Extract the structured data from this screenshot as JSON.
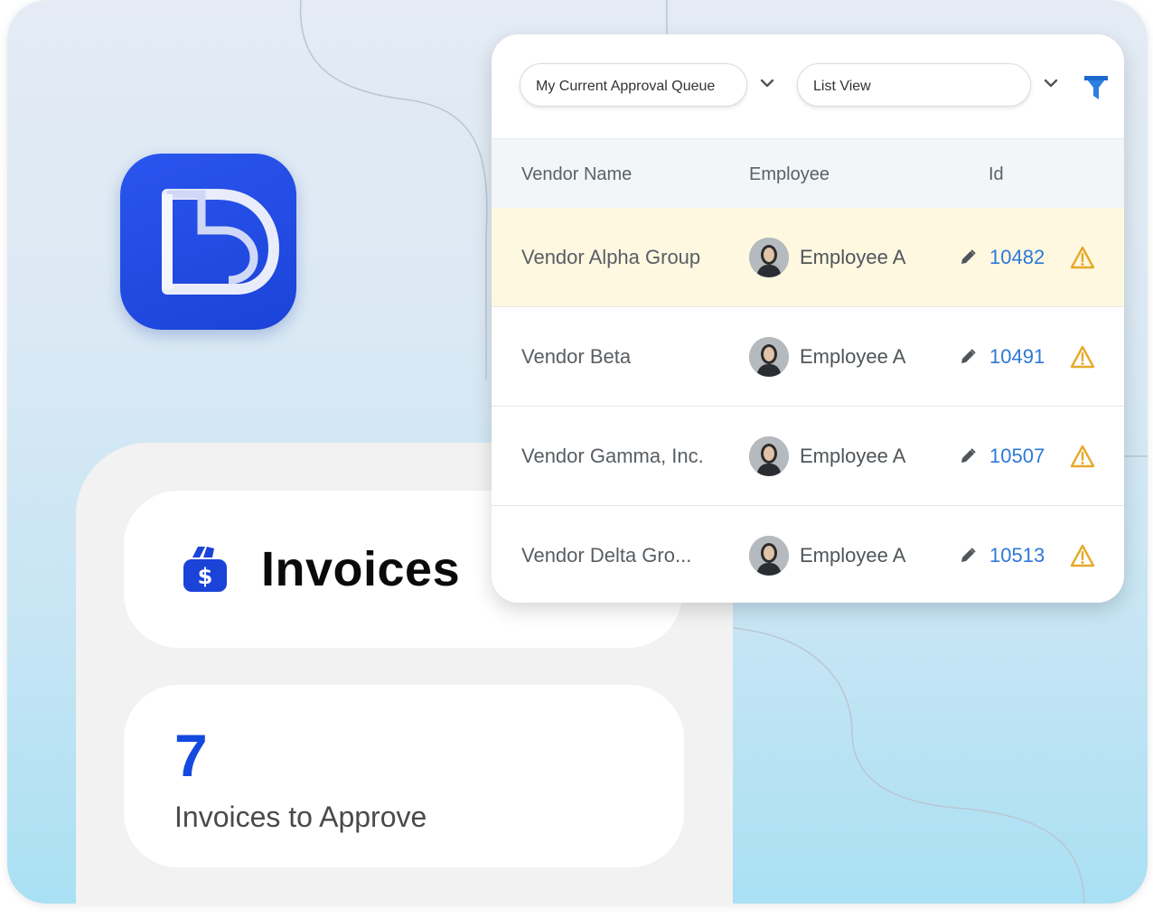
{
  "app": {
    "logo_icon": "brand-d-logo-icon",
    "accent_color": "#1b43d8"
  },
  "invoices_card": {
    "icon": "money-bag-icon",
    "title": "Invoices"
  },
  "summary": {
    "count": "7",
    "label": "Invoices to Approve"
  },
  "toolbar": {
    "queue_select": "My Current Approval Queue",
    "view_select": "List View",
    "filter_icon": "filter-icon"
  },
  "table": {
    "headers": {
      "vendor": "Vendor Name",
      "employee": "Employee",
      "id": "Id"
    },
    "rows": [
      {
        "vendor": "Vendor Alpha Group",
        "employee": "Employee A",
        "id": "10482"
      },
      {
        "vendor": "Vendor Beta",
        "employee": "Employee A",
        "id": "10491"
      },
      {
        "vendor": "Vendor Gamma, Inc.",
        "employee": "Employee A",
        "id": "10507"
      },
      {
        "vendor": "Vendor Delta Gro...",
        "employee": "Employee A",
        "id": "10513"
      }
    ],
    "highlight_color": "#fef8e1",
    "id_link_color": "#2f78d8",
    "warning_color": "#e6a92a"
  }
}
